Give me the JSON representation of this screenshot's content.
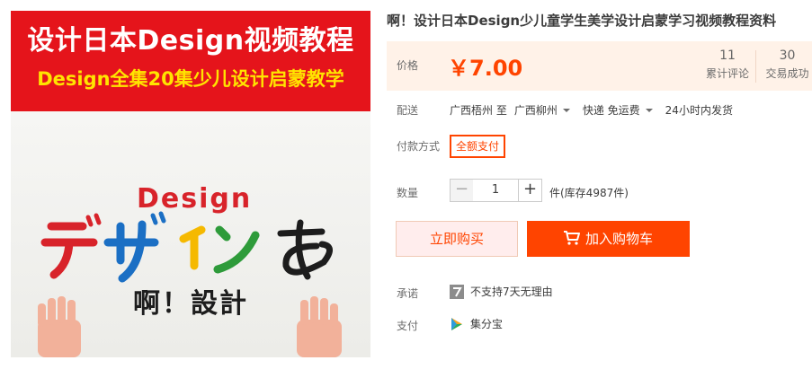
{
  "image": {
    "banner_line1": "设计日本Design视频教程",
    "banner_line2": "Design全集20集少儿设计启蒙教学",
    "photo_word": "Design",
    "photo_sign": "啊！設計"
  },
  "product": {
    "title": "啊！设计日本Design少儿童学生美学设计启蒙学习视频教程资料"
  },
  "price": {
    "label": "价格",
    "value": "￥7.00",
    "reviews_count": "11",
    "reviews_label": "累计评论",
    "trades_count": "30",
    "trades_label": "交易成功"
  },
  "shipping": {
    "label": "配送",
    "from": "广西梧州 至",
    "to": "广西柳州",
    "method": "快递 免运费",
    "dispatch": "24小时内发货"
  },
  "payment_method": {
    "label": "付款方式",
    "option": "全额支付"
  },
  "quantity": {
    "label": "数量",
    "minus": "−",
    "value": "1",
    "plus": "+",
    "stock": "件(库存4987件)"
  },
  "actions": {
    "buy_now": "立即购买",
    "add_to_cart": "加入购物车"
  },
  "promise": {
    "label": "承诺",
    "text": "不支持7天无理由"
  },
  "pay": {
    "label": "支付",
    "text": "集分宝"
  },
  "colors": {
    "accent": "#ff4400",
    "banner_red": "#e5141b",
    "banner_yellow": "#ffe400",
    "price_bg": "#fff2e8"
  },
  "icons": {
    "cart": "cart-icon",
    "no_return": "no-return-7day-icon",
    "jifenbao": "jifenbao-icon"
  }
}
